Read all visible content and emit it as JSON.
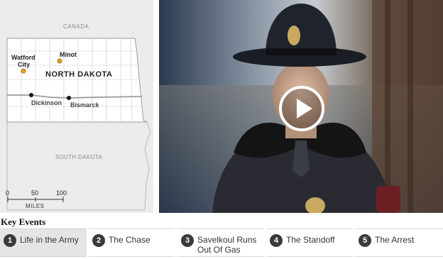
{
  "map": {
    "country_label": "CANADA",
    "state_label": "NORTH DAKOTA",
    "neighbor_label": "SOUTH DAKOTA",
    "cities": [
      {
        "name_line1": "Watford",
        "name_line2": "City",
        "highlight": true
      },
      {
        "name_line1": "Minot",
        "name_line2": "",
        "highlight": true
      },
      {
        "name_line1": "Dickinson",
        "name_line2": "",
        "highlight": false
      },
      {
        "name_line1": "Bismarck",
        "name_line2": "",
        "highlight": false
      }
    ],
    "scale": {
      "ticks": [
        "0",
        "50",
        "100"
      ],
      "unit": "MILES"
    },
    "colors": {
      "highlight_city": "#e8a317",
      "city": "#111111",
      "state_fill": "#ffffff",
      "outside": "#ececec"
    }
  },
  "video": {
    "play_icon": "play-icon",
    "accent": "#ffffff"
  },
  "key_events": {
    "title": "Key Events",
    "items": [
      {
        "number": "1",
        "label": "Life in the Army",
        "active": true
      },
      {
        "number": "2",
        "label": "The Chase",
        "active": false
      },
      {
        "number": "3",
        "label": "Savelkoul Runs Out Of Gas",
        "active": false
      },
      {
        "number": "4",
        "label": "The Standoff",
        "active": false
      },
      {
        "number": "5",
        "label": "The Arrest",
        "active": false
      }
    ]
  }
}
